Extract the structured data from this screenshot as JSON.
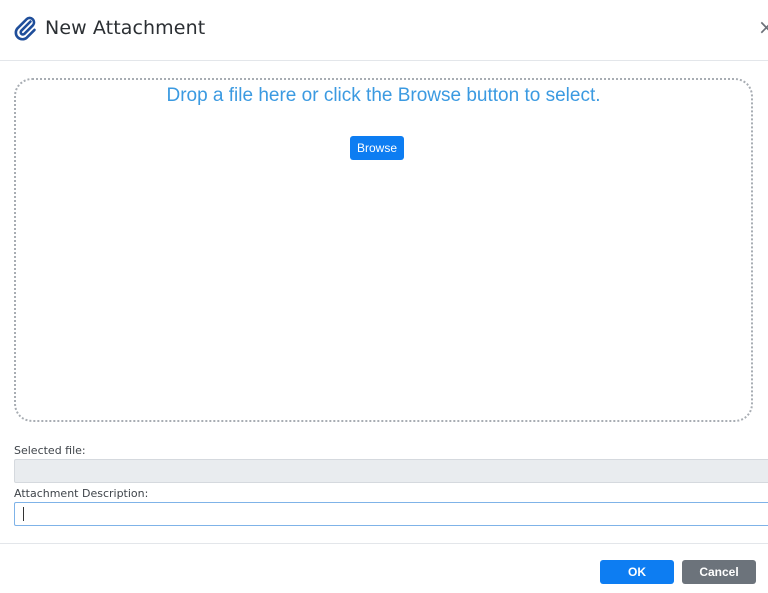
{
  "dialog": {
    "title": "New Attachment",
    "icon": "paperclip-icon",
    "close_icon": "close-icon",
    "close_glyph": "×"
  },
  "dropzone": {
    "hint": "Drop a file here or click the Browse button to select.",
    "browse_label": "Browse"
  },
  "form": {
    "selected_file_label": "Selected file:",
    "selected_file_value": "",
    "description_label": "Attachment Description:",
    "description_value": ""
  },
  "footer": {
    "ok_label": "OK",
    "cancel_label": "Cancel"
  },
  "colors": {
    "accent": "#0d7df2",
    "hint_text": "#3b9ae1",
    "cancel": "#6c737b"
  }
}
